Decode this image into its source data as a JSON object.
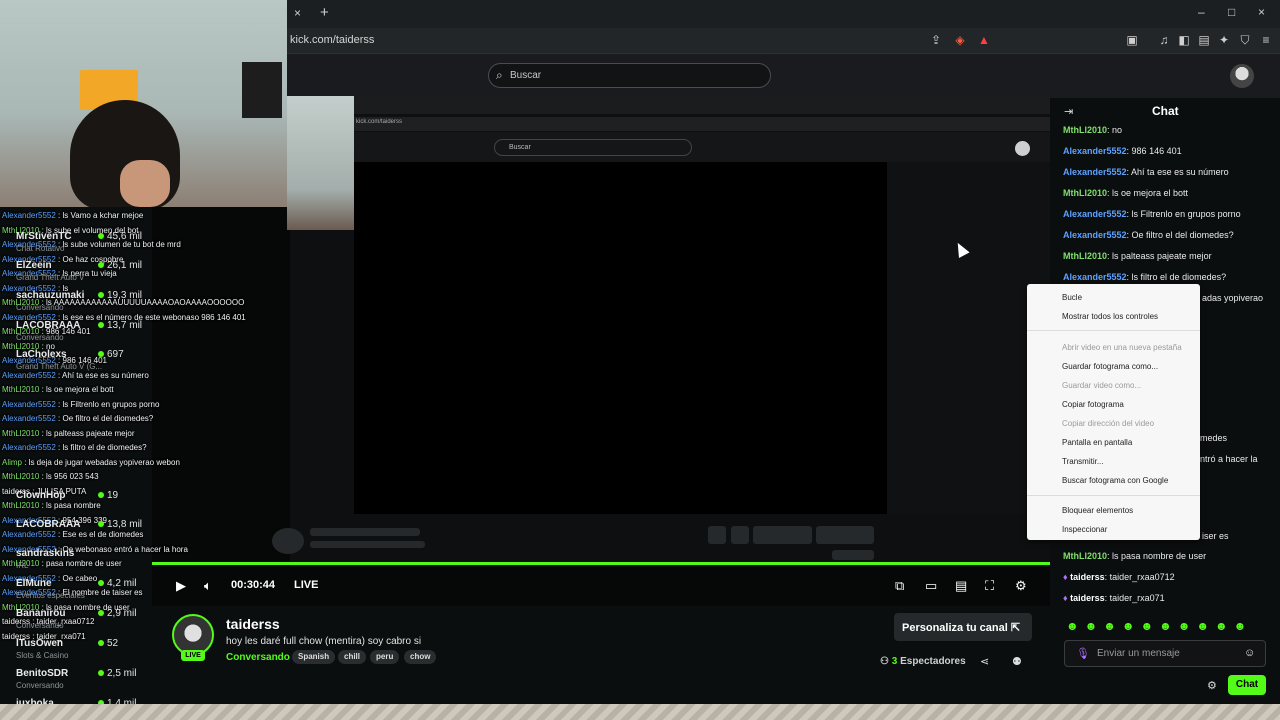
{
  "browser": {
    "url": "kick.com/taiderss",
    "tab_close": "×",
    "tab_new": "+",
    "window_buttons": [
      "–",
      "□",
      "×"
    ]
  },
  "header": {
    "search_placeholder": "Buscar"
  },
  "inner": {
    "url": "kick.com/taiderss",
    "search": "Buscar"
  },
  "overlay_chat": [
    {
      "user": "Alexander5552",
      "msg": "ls Vamo a kchar mejoe",
      "c": "b"
    },
    {
      "user": "MthLl2010",
      "msg": "ls sube el volumen del bot",
      "c": "g"
    },
    {
      "user": "Alexander5552",
      "msg": "ls sube volumen de tu bot de mrd",
      "c": "b"
    },
    {
      "user": "Alexander5552",
      "msg": "Oe haz cospobre",
      "c": "b"
    },
    {
      "user": "Alexander5552",
      "msg": "ls perra tu vieja",
      "c": "b"
    },
    {
      "user": "Alexander5552",
      "msg": "ls",
      "c": "b"
    },
    {
      "user": "MthLl2010",
      "msg": "ls AAAAAAAAAAAAUUUUUAAAAOAOAAAAOOOOOO",
      "c": "g"
    },
    {
      "user": "Alexander5552",
      "msg": "ls ese es el número de este webonaso 986 146 401",
      "c": "b"
    },
    {
      "user": "MthLl2010",
      "msg": "986 146 401",
      "c": "g"
    },
    {
      "user": "MthLl2010",
      "msg": "no",
      "c": "g"
    },
    {
      "user": "Alexander5552",
      "msg": "986 146 401",
      "c": "b"
    },
    {
      "user": "Alexander5552",
      "msg": "Ahí ta ese es su número",
      "c": "b"
    },
    {
      "user": "MthLl2010",
      "msg": "ls oe mejora el bott",
      "c": "g"
    },
    {
      "user": "Alexander5552",
      "msg": "ls Filtrenlo en grupos porno",
      "c": "b"
    },
    {
      "user": "Alexander5552",
      "msg": "Oe filtro el del diomedes?",
      "c": "b"
    },
    {
      "user": "MthLl2010",
      "msg": "ls palteass pajeate mejor",
      "c": "g"
    },
    {
      "user": "Alexander5552",
      "msg": "ls filtro el de diomedes?",
      "c": "b"
    },
    {
      "user": "Alimp",
      "msg": "ls deja de jugar webadas yopiverao webon",
      "c": "g"
    },
    {
      "user": "MthLl2010",
      "msg": "ls 956 023 543",
      "c": "g"
    },
    {
      "user": "taiderss",
      "msg": "JULISA PUTA",
      "c": "w"
    },
    {
      "user": "MthLl2010",
      "msg": "ls pasa nombre",
      "c": "g"
    },
    {
      "user": "Alexander5552",
      "msg": "954 396 339",
      "c": "b"
    },
    {
      "user": "Alexander5552",
      "msg": "Ese es el de diomedes",
      "c": "b"
    },
    {
      "user": "Alexander5552",
      "msg": "Oe webonaso entró a hacer la hora",
      "c": "b"
    },
    {
      "user": "MthLl2010",
      "msg": "pasa nombre de user",
      "c": "g"
    },
    {
      "user": "Alexander5552",
      "msg": "Oe cabeo",
      "c": "b"
    },
    {
      "user": "Alexander5552",
      "msg": "El nombre de taiser es",
      "c": "b"
    },
    {
      "user": "MthLl2010",
      "msg": "ls pasa nombre de user",
      "c": "g"
    },
    {
      "user": "taiderss",
      "msg": "taider_rxaa0712",
      "c": "w"
    },
    {
      "user": "taiderss",
      "msg": "taider_rxa071",
      "c": "w"
    }
  ],
  "side_channels": [
    {
      "name": "MrStivenTC",
      "game": "Chat Rotativo",
      "viewers": "45,6 mil"
    },
    {
      "name": "ElZeein",
      "game": "Grand Theft Auto V",
      "viewers": "26,1 mil"
    },
    {
      "name": "sachauzumaki",
      "game": "Conversando",
      "viewers": "19,3 mil"
    },
    {
      "name": "LACOBRAAA",
      "game": "Conversando",
      "viewers": "13,7 mil"
    },
    {
      "name": "LaCholexs",
      "game": "Grand Theft Auto V (G...",
      "viewers": "697"
    },
    {
      "name": "ClownHop",
      "game": "",
      "viewers": "19"
    },
    {
      "name": "LACOBRAAA",
      "game": "",
      "viewers": "13,8 mil"
    },
    {
      "name": "sandraskins",
      "game": "IRL",
      "viewers": ""
    },
    {
      "name": "ElMune",
      "game": "Eventos especiales",
      "viewers": "4,2 mil"
    },
    {
      "name": "Bananirou",
      "game": "Conversando",
      "viewers": "2,9 mil"
    },
    {
      "name": "ITusOwen",
      "game": "Slots & Casino",
      "viewers": "52"
    },
    {
      "name": "BenitoSDR",
      "game": "Conversando",
      "viewers": "2,5 mil"
    },
    {
      "name": "iuxboka",
      "game": "",
      "viewers": "1,4 mil"
    }
  ],
  "player": {
    "time": "00:30:44",
    "live": "LIVE"
  },
  "stream": {
    "streamer": "taiderss",
    "live_badge": "LIVE",
    "title": "hoy les daré full chow (mentira) soy cabro si",
    "category": "Conversando",
    "tags": [
      "Spanish",
      "chill",
      "peru",
      "chow"
    ],
    "personaliza": "Personaliza tu canal",
    "viewers_count": "3",
    "viewers_label": "Espectadores"
  },
  "chat": {
    "title": "Chat",
    "messages": [
      {
        "user": "MthLl2010",
        "msg": "no",
        "c": "g"
      },
      {
        "user": "Alexander5552",
        "msg": "986 146 401",
        "c": "b"
      },
      {
        "user": "Alexander5552",
        "msg": "Ahí ta ese es su número",
        "c": "b"
      },
      {
        "user": "MthLl2010",
        "msg": "ls oe mejora el bott",
        "c": "g"
      },
      {
        "user": "Alexander5552",
        "msg": "ls Filtrenlo en grupos porno",
        "c": "b"
      },
      {
        "user": "Alexander5552",
        "msg": "Oe filtro el del diomedes?",
        "c": "b"
      },
      {
        "user": "MthLl2010",
        "msg": "ls palteass pajeate mejor",
        "c": "g"
      },
      {
        "user": "Alexander5552",
        "msg": "ls filtro el de diomedes?",
        "c": "b"
      }
    ],
    "partial": [
      "adas yopiverao",
      "medes",
      "ntró a hacer la",
      "r",
      "iser es"
    ],
    "bottom_messages": [
      {
        "user": "MthLl2010",
        "msg": "ls pasa nombre de user",
        "c": "g"
      },
      {
        "user": "taiderss",
        "msg": "taider_rxaa0712",
        "c": "w"
      },
      {
        "user": "taiderss",
        "msg": "taider_rxa071",
        "c": "w"
      }
    ],
    "placeholder": "Enviar un mensaje",
    "send_label": "Chat"
  },
  "context_menu": [
    {
      "label": "Bucle",
      "disabled": false
    },
    {
      "label": "Mostrar todos los controles",
      "disabled": false
    },
    {
      "label": "Abrir video en una nueva pestaña",
      "disabled": true
    },
    {
      "label": "Guardar fotograma como...",
      "disabled": false
    },
    {
      "label": "Guardar video como...",
      "disabled": true
    },
    {
      "label": "Copiar fotograma",
      "disabled": false
    },
    {
      "label": "Copiar dirección del video",
      "disabled": true
    },
    {
      "label": "Pantalla en pantalla",
      "disabled": false
    },
    {
      "label": "Transmitir...",
      "disabled": false
    },
    {
      "label": "Buscar fotograma con Google",
      "disabled": false
    },
    {
      "label": "Bloquear elementos",
      "disabled": false
    },
    {
      "label": "Inspeccionar",
      "disabled": false
    }
  ],
  "colors": {
    "accent": "#53fc18",
    "user_blue": "#5da2ff",
    "user_green": "#7ee06a"
  }
}
